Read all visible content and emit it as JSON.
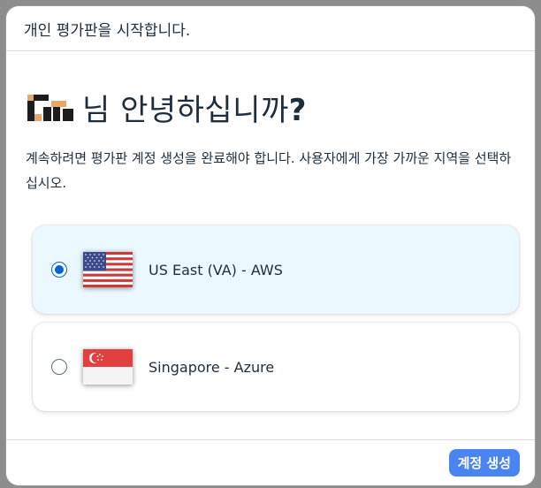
{
  "dialog": {
    "title": "개인 평가판을 시작합니다."
  },
  "greeting": {
    "text": "님 안녕하십니까",
    "punctuation": "?"
  },
  "description": "계속하려면 평가판 계정 생성을 완료해야 합니다. 사용자에게 가장 가까운 지역을 선택하십시오.",
  "regions": [
    {
      "label": "US East (VA) - AWS",
      "selected": true,
      "flag": "us-flag-icon"
    },
    {
      "label": "Singapore - Azure",
      "selected": false,
      "flag": "singapore-flag-icon"
    }
  ],
  "footer": {
    "create_label": "계정 생성"
  },
  "colors": {
    "accent": "#0064d9",
    "button": "#4a84f0",
    "selected_card": "#ebf8ff",
    "text": "#1d2d3e",
    "logo_orange": "#e8a76c"
  }
}
